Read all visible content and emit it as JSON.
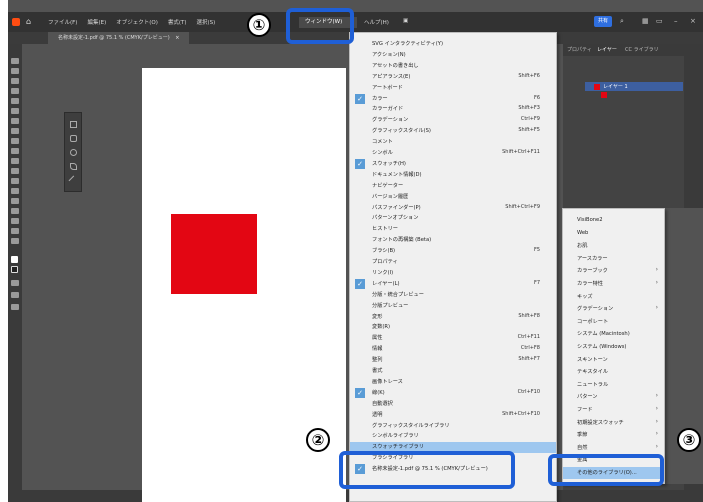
{
  "menubar": {
    "items": [
      "ファイル(F)",
      "編集(E)",
      "オブジェクト(O)",
      "書式(T)",
      "選択(S)"
    ],
    "window_menu": "ウィンドウ(W)",
    "after_items": [
      "ヘルプ(H)",
      "▣"
    ],
    "share_label": "共有"
  },
  "doc_tab": {
    "title": "名称未設定-1.pdf @ 75.1 % (CMYK/プレビュー)",
    "close": "×"
  },
  "panel": {
    "tabs": [
      "プロパティ",
      "レイヤー",
      "CC ライブラリ"
    ],
    "layer_label": "レイヤー 1",
    "sub_label": "<..."
  },
  "window_menu_items": [
    {
      "label": "SVG インタラクティビティ(Y)",
      "shortcut": ""
    },
    {
      "label": "アクション(N)",
      "shortcut": ""
    },
    {
      "label": "アセットの書き出し",
      "shortcut": ""
    },
    {
      "label": "アピアランス(E)",
      "shortcut": "Shift+F6"
    },
    {
      "label": "アートボード",
      "shortcut": ""
    },
    {
      "label": "カラー",
      "shortcut": "F6",
      "checked": true
    },
    {
      "label": "カラーガイド",
      "shortcut": "Shift+F3"
    },
    {
      "label": "グラデーション",
      "shortcut": "Ctrl+F9"
    },
    {
      "label": "グラフィックスタイル(S)",
      "shortcut": "Shift+F5"
    },
    {
      "label": "コメント",
      "shortcut": ""
    },
    {
      "label": "シンボル",
      "shortcut": "Shift+Ctrl+F11"
    },
    {
      "label": "スウォッチ(H)",
      "shortcut": "",
      "checked": true
    },
    {
      "label": "ドキュメント情報(D)",
      "shortcut": ""
    },
    {
      "label": "ナビゲーター",
      "shortcut": ""
    },
    {
      "label": "バージョン履歴",
      "shortcut": ""
    },
    {
      "label": "パスファインダー(P)",
      "shortcut": "Shift+Ctrl+F9"
    },
    {
      "label": "パターンオプション",
      "shortcut": ""
    },
    {
      "label": "ヒストリー",
      "shortcut": ""
    },
    {
      "label": "フォントの再構築 (Beta)",
      "shortcut": ""
    },
    {
      "label": "ブラシ(B)",
      "shortcut": "F5"
    },
    {
      "label": "プロパティ",
      "shortcut": ""
    },
    {
      "label": "リンク(I)",
      "shortcut": ""
    },
    {
      "label": "レイヤー(L)",
      "shortcut": "F7",
      "checked": true
    },
    {
      "label": "分版・統合プレビュー",
      "shortcut": ""
    },
    {
      "label": "分版プレビュー",
      "shortcut": ""
    },
    {
      "label": "変形",
      "shortcut": "Shift+F8"
    },
    {
      "label": "変数(R)",
      "shortcut": ""
    },
    {
      "label": "属性",
      "shortcut": "Ctrl+F11"
    },
    {
      "label": "情報",
      "shortcut": "Ctrl+F8"
    },
    {
      "label": "整列",
      "shortcut": "Shift+F7"
    },
    {
      "label": "書式",
      "shortcut": ""
    },
    {
      "label": "画像トレース",
      "shortcut": ""
    },
    {
      "label": "線(K)",
      "shortcut": "Ctrl+F10",
      "checked": true
    },
    {
      "label": "自動選択",
      "shortcut": ""
    },
    {
      "label": "透明",
      "shortcut": "Shift+Ctrl+F10"
    },
    {
      "label": "グラフィックスタイルライブラリ",
      "shortcut": ""
    },
    {
      "label": "シンボルライブラリ",
      "shortcut": ""
    },
    {
      "label": "スウォッチライブラリ",
      "shortcut": "",
      "highlight": true
    },
    {
      "label": "ブラシライブラリ",
      "shortcut": ""
    },
    {
      "label": "名称未設定-1.pdf @ 75.1 % (CMYK/プレビュー)",
      "shortcut": "",
      "checked": true
    }
  ],
  "swatch_library_submenu": [
    {
      "label": "VisiBone2",
      "arrow": false
    },
    {
      "label": "Web",
      "arrow": false
    },
    {
      "label": "お肌",
      "arrow": false
    },
    {
      "label": "アースカラー",
      "arrow": false
    },
    {
      "label": "カラーブック",
      "arrow": true
    },
    {
      "label": "カラー特性",
      "arrow": true
    },
    {
      "label": "キッズ",
      "arrow": false
    },
    {
      "label": "グラデーション",
      "arrow": true
    },
    {
      "label": "コーポレート",
      "arrow": false
    },
    {
      "label": "システム (Macintosh)",
      "arrow": false
    },
    {
      "label": "システム (Windows)",
      "arrow": false
    },
    {
      "label": "スキントーン",
      "arrow": false
    },
    {
      "label": "テキスタイル",
      "arrow": false
    },
    {
      "label": "ニュートラル",
      "arrow": false
    },
    {
      "label": "パターン",
      "arrow": true
    },
    {
      "label": "フード",
      "arrow": true
    },
    {
      "label": "初期設定スウォッチ",
      "arrow": true
    },
    {
      "label": "季節",
      "arrow": true
    },
    {
      "label": "自然",
      "arrow": true
    },
    {
      "label": "金属",
      "arrow": false
    },
    {
      "label": "その他のライブラリ(O)...",
      "arrow": false,
      "highlight": true
    }
  ],
  "callouts": [
    "①",
    "②",
    "③"
  ],
  "colors": {
    "accent_blue": "#1f5fd6",
    "menu_highlight": "#9ec7ef",
    "red_square": "#e30613"
  }
}
